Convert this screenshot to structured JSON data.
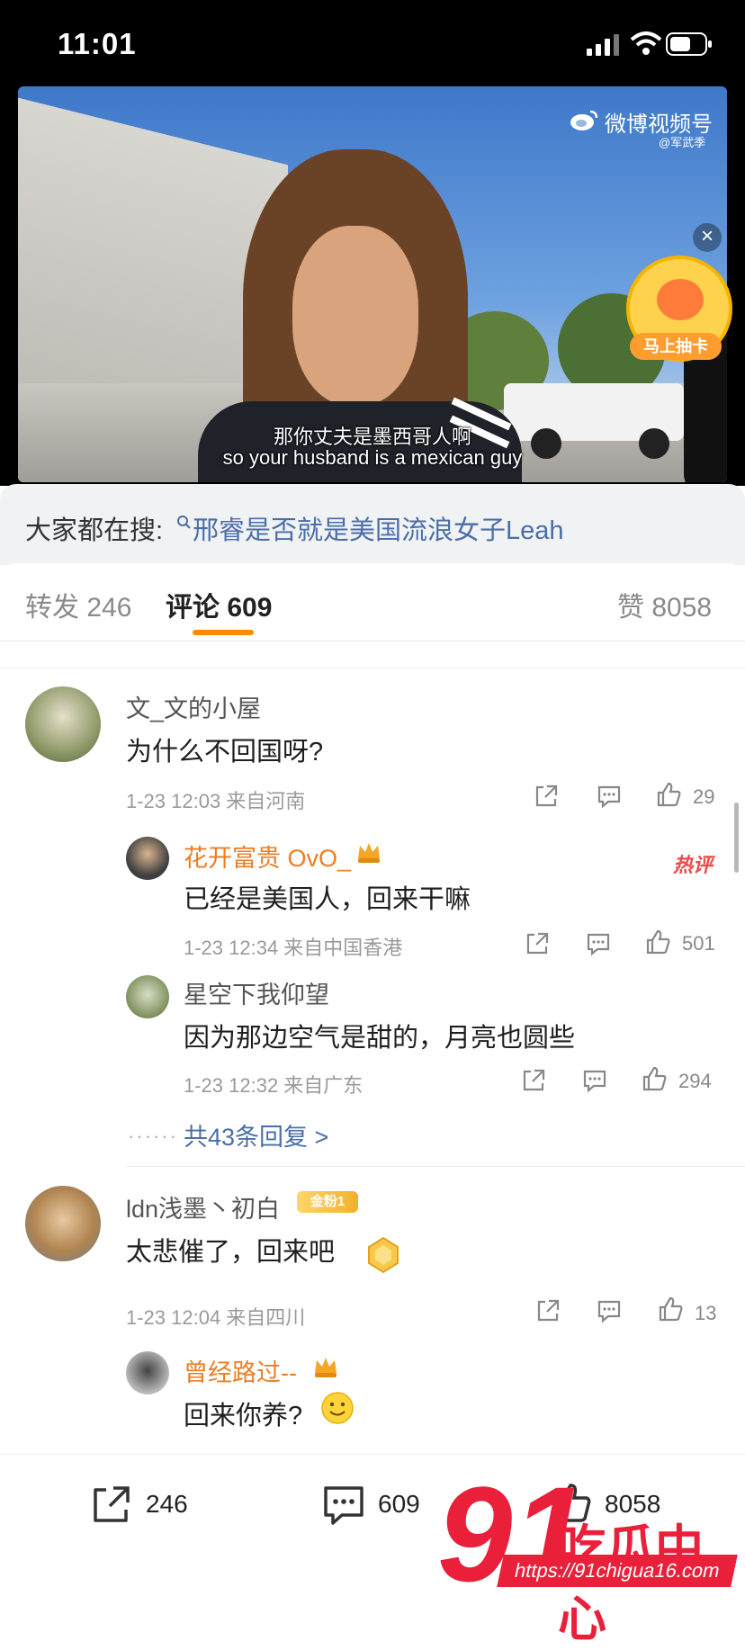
{
  "status_bar": {
    "time": "11:01"
  },
  "video": {
    "brand": "微博视频号",
    "brand_sub": "@军武季",
    "subtitle_cn": "那你丈夫是墨西哥人啊",
    "subtitle_en": "so your husband is a mexican guy",
    "close_symbol": "×",
    "badge_label": "马上抽卡"
  },
  "search": {
    "prefix": "大家都在搜:",
    "query": "邢睿是否就是美国流浪女子Leah"
  },
  "tabs": {
    "repost": "转发 246",
    "comment": "评论 609",
    "like": "赞 8058"
  },
  "comments": [
    {
      "user": "文_文的小屋",
      "text": "为什么不回国呀?",
      "meta": "1-23 12:03  来自河南",
      "likes": "29",
      "replies": [
        {
          "user": "花开富贵 OvO_",
          "text": "已经是美国人，回来干嘛",
          "meta": "1-23 12:34  来自中国香港",
          "likes": "501",
          "tag": "热评"
        },
        {
          "user": "星空下我仰望",
          "text": "因为那边空气是甜的，月亮也圆些",
          "meta": "1-23 12:32  来自广东",
          "likes": "294"
        }
      ],
      "more": "共43条回复 >"
    },
    {
      "user": "ldn浅墨丶初白",
      "badge": "金粉1",
      "text": "太悲催了，回来吧",
      "meta": "1-23 12:04  来自四川",
      "likes": "13",
      "replies": [
        {
          "user": "曾经路过--",
          "text": "回来你养?"
        }
      ]
    }
  ],
  "bottom": {
    "repost": "246",
    "comment": "609",
    "like": "8058"
  },
  "watermark": {
    "number": "91",
    "text": "吃瓜中心",
    "url": "https://91chigua16.com"
  },
  "colors": {
    "accent": "#ff8a00",
    "link": "#4a6ea9",
    "name_orange": "#ee7d22",
    "watermark": "#ea1f3a"
  }
}
